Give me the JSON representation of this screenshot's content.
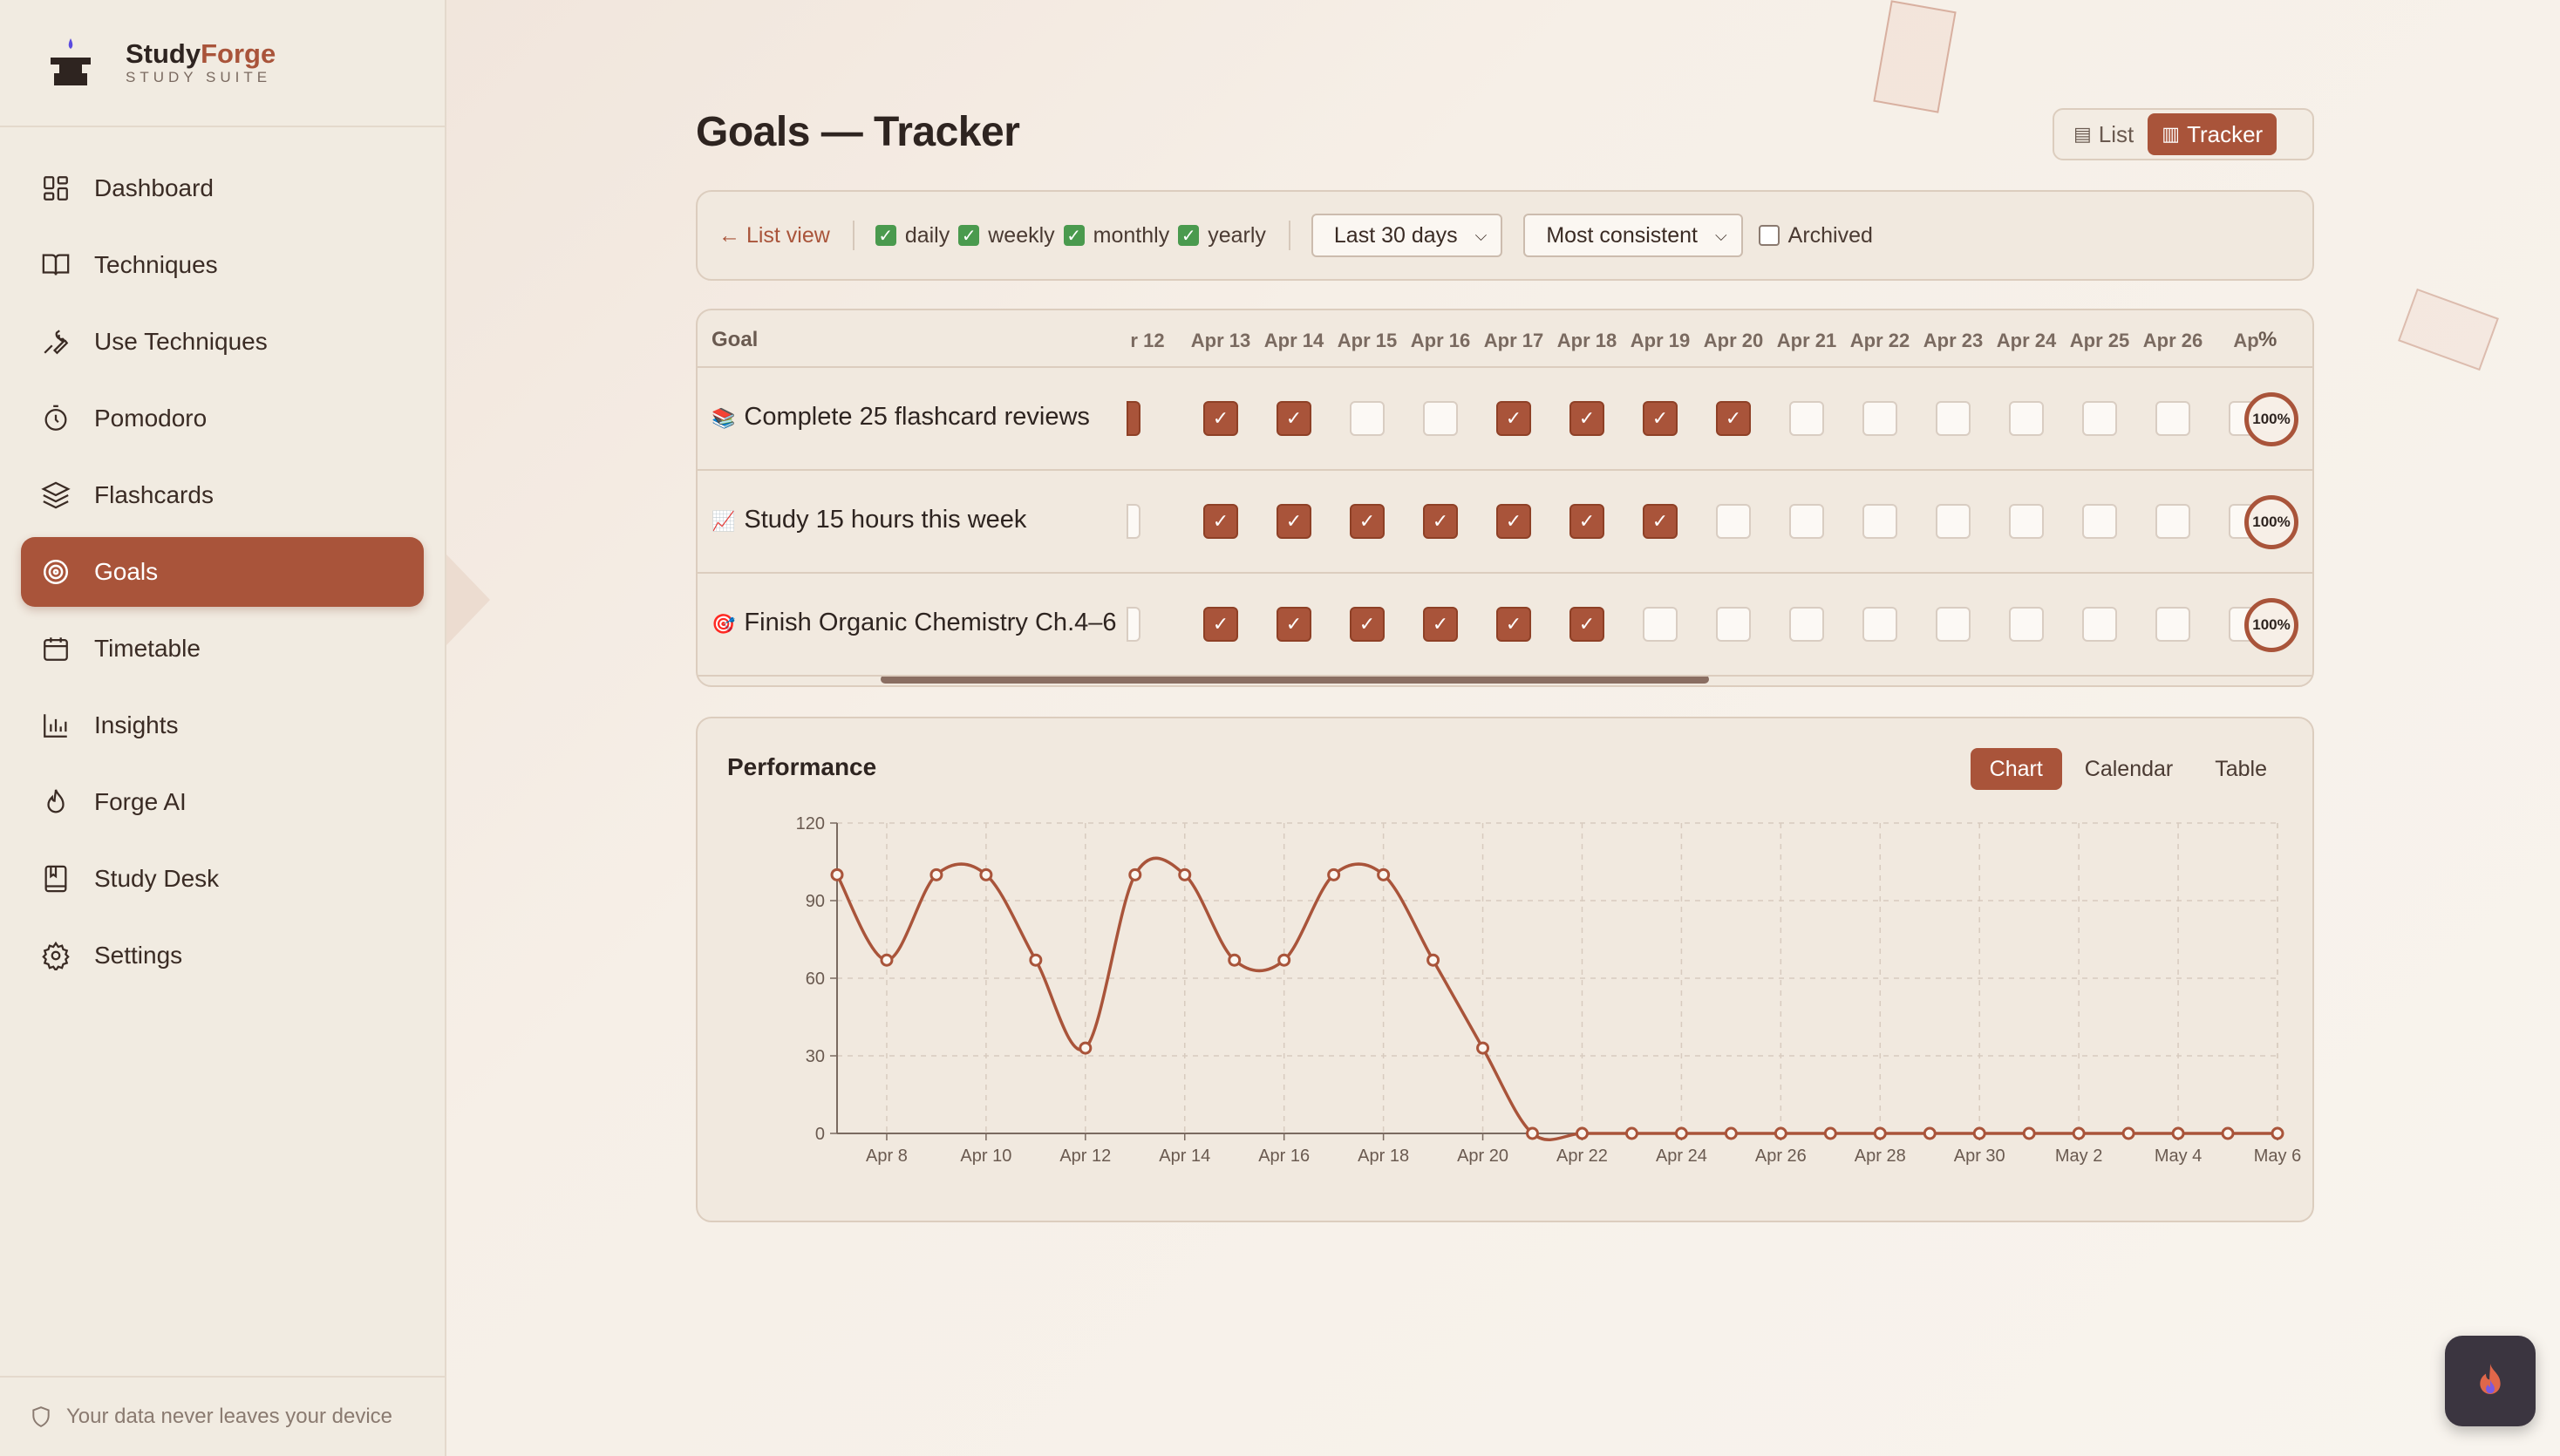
{
  "brand": {
    "name_part1": "Study",
    "name_part2": "Forge",
    "subtitle": "STUDY SUITE"
  },
  "sidebar": {
    "items": [
      {
        "label": "Dashboard",
        "icon": "grid-icon"
      },
      {
        "label": "Techniques",
        "icon": "book-icon"
      },
      {
        "label": "Use Techniques",
        "icon": "wrench-icon"
      },
      {
        "label": "Pomodoro",
        "icon": "timer-icon"
      },
      {
        "label": "Flashcards",
        "icon": "layers-icon"
      },
      {
        "label": "Goals",
        "icon": "target-icon",
        "active": true
      },
      {
        "label": "Timetable",
        "icon": "calendar-icon"
      },
      {
        "label": "Insights",
        "icon": "bar-chart-icon"
      },
      {
        "label": "Forge AI",
        "icon": "flame-icon"
      },
      {
        "label": "Study Desk",
        "icon": "notebook-icon"
      },
      {
        "label": "Settings",
        "icon": "gear-icon"
      }
    ],
    "footer": "Your data never leaves your device"
  },
  "header": {
    "title": "Goals — Tracker",
    "view_list": "List",
    "view_tracker": "Tracker"
  },
  "filters": {
    "back": "← List view",
    "daily": "daily",
    "weekly": "weekly",
    "monthly": "monthly",
    "yearly": "yearly",
    "range": "Last 30 days",
    "sort": "Most consistent",
    "archived": "Archived"
  },
  "tracker": {
    "goal_header": "Goal",
    "pct_header": "%",
    "dates": [
      "r 12",
      "Apr 13",
      "Apr 14",
      "Apr 15",
      "Apr 16",
      "Apr 17",
      "Apr 18",
      "Apr 19",
      "Apr 20",
      "Apr 21",
      "Apr 22",
      "Apr 23",
      "Apr 24",
      "Apr 25",
      "Apr 26",
      "Ap"
    ],
    "goals": [
      {
        "icon": "📚",
        "name": "Complete 25 flashcard reviews",
        "pct": "100%",
        "checks": [
          1,
          1,
          1,
          0,
          0,
          1,
          1,
          1,
          1,
          0,
          0,
          0,
          0,
          0,
          0,
          0
        ]
      },
      {
        "icon": "📈",
        "name": "Study 15 hours this week",
        "pct": "100%",
        "checks": [
          0,
          1,
          1,
          1,
          1,
          1,
          1,
          1,
          0,
          0,
          0,
          0,
          0,
          0,
          0,
          0
        ]
      },
      {
        "icon": "🎯",
        "name": "Finish Organic Chemistry Ch.4–6",
        "pct": "100%",
        "checks": [
          0,
          1,
          1,
          1,
          1,
          1,
          1,
          0,
          0,
          0,
          0,
          0,
          0,
          0,
          0,
          0
        ]
      }
    ]
  },
  "performance": {
    "title": "Performance",
    "tabs": [
      "Chart",
      "Calendar",
      "Table"
    ],
    "active_tab": "Chart"
  },
  "chart_data": {
    "type": "line",
    "x_ticks": [
      "Apr 8",
      "Apr 10",
      "Apr 12",
      "Apr 14",
      "Apr 16",
      "Apr 18",
      "Apr 20",
      "Apr 22",
      "Apr 24",
      "Apr 26",
      "Apr 28",
      "Apr 30",
      "May 2",
      "May 4",
      "May 6"
    ],
    "x": [
      "Apr 7",
      "Apr 8",
      "Apr 9",
      "Apr 10",
      "Apr 11",
      "Apr 12",
      "Apr 13",
      "Apr 14",
      "Apr 15",
      "Apr 16",
      "Apr 17",
      "Apr 18",
      "Apr 19",
      "Apr 20",
      "Apr 21",
      "Apr 22",
      "Apr 23",
      "Apr 24",
      "Apr 25",
      "Apr 26",
      "Apr 27",
      "Apr 28",
      "Apr 29",
      "Apr 30",
      "May 1",
      "May 2",
      "May 3",
      "May 4",
      "May 5",
      "May 6"
    ],
    "values": [
      100,
      67,
      100,
      100,
      67,
      33,
      100,
      100,
      67,
      67,
      100,
      100,
      67,
      33,
      0,
      0,
      0,
      0,
      0,
      0,
      0,
      0,
      0,
      0,
      0,
      0,
      0,
      0,
      0,
      0
    ],
    "y_ticks": [
      0,
      30,
      60,
      90,
      120
    ],
    "ylim": [
      0,
      120
    ],
    "grid": true,
    "color": "#a9543a"
  }
}
